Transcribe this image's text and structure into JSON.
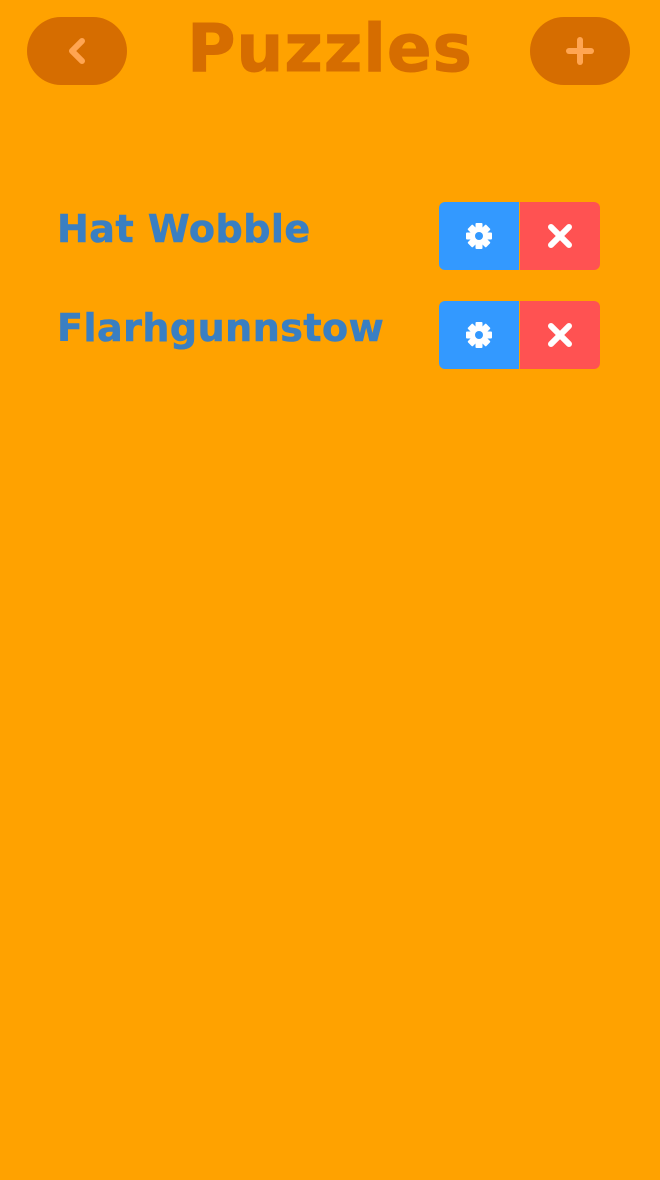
{
  "header": {
    "title": "Puzzles",
    "back_icon": "chevron-left-icon",
    "add_icon": "plus-icon"
  },
  "puzzles": [
    {
      "name": "Hat Wobble",
      "settings_icon": "gear-icon",
      "delete_icon": "close-icon"
    },
    {
      "name": "Flarhgunnstow",
      "settings_icon": "gear-icon",
      "delete_icon": "close-icon"
    }
  ],
  "colors": {
    "background": "#ffa200",
    "header_button": "#d66d00",
    "header_icon": "#ffa552",
    "title": "#d66d00",
    "puzzle_name": "#3a7fc2",
    "settings_button": "#3399ff",
    "delete_button": "#ff5252",
    "button_icon": "#ffffff"
  }
}
